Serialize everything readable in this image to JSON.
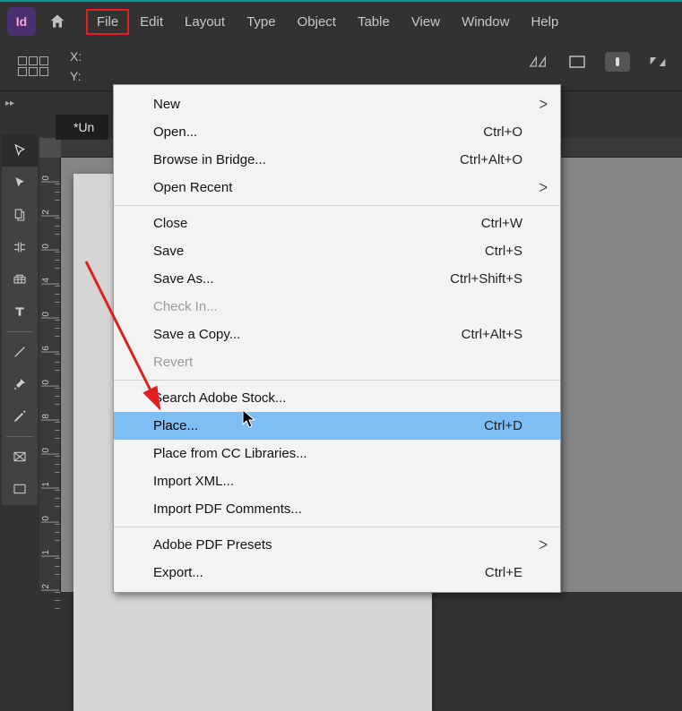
{
  "menubar": {
    "app_label": "Id",
    "items": [
      "File",
      "Edit",
      "Layout",
      "Type",
      "Object",
      "Table",
      "View",
      "Window",
      "Help"
    ],
    "active_index": 0
  },
  "control_bar": {
    "x_label": "X:",
    "y_label": "Y:"
  },
  "doc_tab": "*Un",
  "ruler_v": {
    "ticks": [
      "0",
      "2",
      "0",
      "4",
      "0",
      "6",
      "0",
      "8",
      "0",
      "1",
      "0",
      "1",
      "2"
    ]
  },
  "dropdown": {
    "groups": [
      [
        {
          "label": "New",
          "shortcut": "",
          "sub": true
        },
        {
          "label": "Open...",
          "shortcut": "Ctrl+O"
        },
        {
          "label": "Browse in Bridge...",
          "shortcut": "Ctrl+Alt+O"
        },
        {
          "label": "Open Recent",
          "shortcut": "",
          "sub": true
        }
      ],
      [
        {
          "label": "Close",
          "shortcut": "Ctrl+W"
        },
        {
          "label": "Save",
          "shortcut": "Ctrl+S"
        },
        {
          "label": "Save As...",
          "shortcut": "Ctrl+Shift+S"
        },
        {
          "label": "Check In...",
          "shortcut": "",
          "disabled": true
        },
        {
          "label": "Save a Copy...",
          "shortcut": "Ctrl+Alt+S"
        },
        {
          "label": "Revert",
          "shortcut": "",
          "disabled": true
        }
      ],
      [
        {
          "label": "Search Adobe Stock...",
          "shortcut": ""
        },
        {
          "label": "Place...",
          "shortcut": "Ctrl+D",
          "highlight": true
        },
        {
          "label": "Place from CC Libraries...",
          "shortcut": ""
        },
        {
          "label": "Import XML...",
          "shortcut": ""
        },
        {
          "label": "Import PDF Comments...",
          "shortcut": ""
        }
      ],
      [
        {
          "label": "Adobe PDF Presets",
          "shortcut": "",
          "sub": true
        },
        {
          "label": "Export...",
          "shortcut": "Ctrl+E"
        }
      ]
    ]
  }
}
